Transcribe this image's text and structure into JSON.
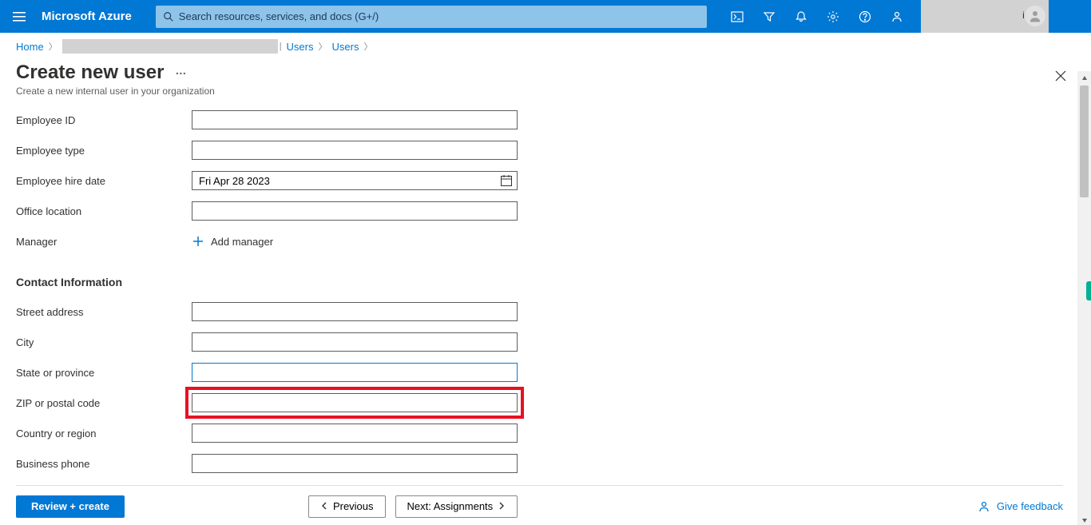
{
  "topbar": {
    "brand": "Microsoft Azure",
    "search_placeholder": "Search resources, services, and docs (G+/)",
    "account_letter": "i"
  },
  "breadcrumb": {
    "home": "Home",
    "users1": "Users",
    "users2": "Users",
    "separator_bar": "|"
  },
  "page": {
    "title": "Create new user",
    "more": "…",
    "subtitle": "Create a new internal user in your organization"
  },
  "form": {
    "employee_id_label": "Employee ID",
    "employee_id_value": "",
    "employee_type_label": "Employee type",
    "employee_type_value": "",
    "hire_date_label": "Employee hire date",
    "hire_date_value": "Fri Apr 28 2023",
    "office_location_label": "Office location",
    "office_location_value": "",
    "manager_label": "Manager",
    "add_manager_label": "Add manager",
    "contact_section": "Contact Information",
    "street_label": "Street address",
    "street_value": "",
    "city_label": "City",
    "city_value": "",
    "state_label": "State or province",
    "state_value": "",
    "zip_label": "ZIP or postal code",
    "zip_value": "",
    "country_label": "Country or region",
    "country_value": "",
    "business_phone_label": "Business phone",
    "business_phone_value": ""
  },
  "footer": {
    "review_create": "Review + create",
    "previous": "Previous",
    "next": "Next: Assignments",
    "feedback": "Give feedback"
  }
}
